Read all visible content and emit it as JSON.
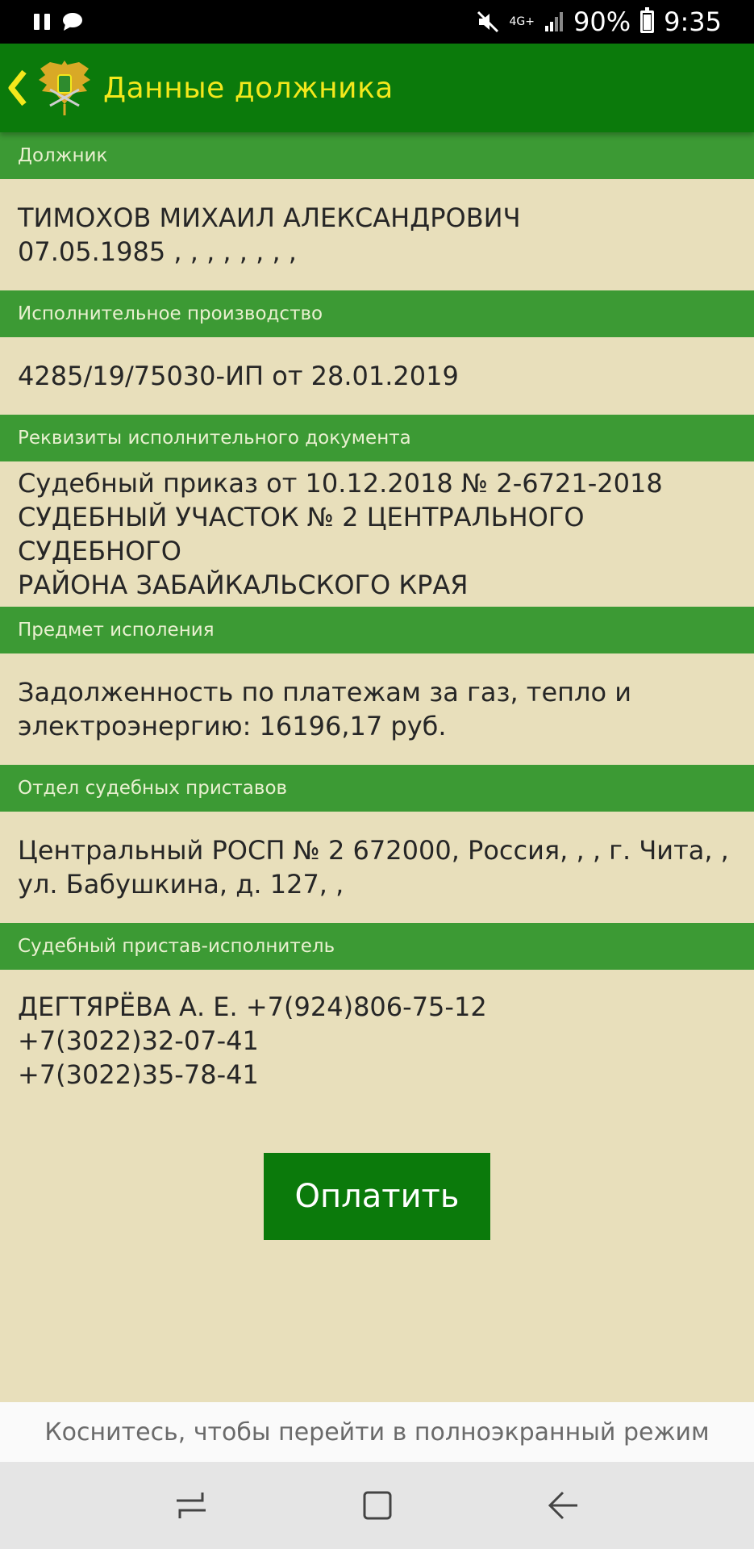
{
  "status_bar": {
    "battery": "90%",
    "time": "9:35",
    "network": "4G+"
  },
  "appbar": {
    "title": "Данные должника"
  },
  "sections": [
    {
      "header": "Должник",
      "lines": [
        "ТИМОХОВ МИХАИЛ АЛЕКСАНДРОВИЧ",
        "07.05.1985 , , , , , , , ,"
      ]
    },
    {
      "header": "Исполнительное производство",
      "lines": [
        "4285/19/75030-ИП от 28.01.2019"
      ]
    },
    {
      "header": "Реквизиты исполнительного документа",
      "lines": [
        "Судебный приказ от 10.12.2018 № 2-6721-2018",
        "СУДЕБНЫЙ УЧАСТОК № 2 ЦЕНТРАЛЬНОГО СУДЕБНОГО",
        "РАЙОНА ЗАБАЙКАЛЬСКОГО КРАЯ"
      ]
    },
    {
      "header": "Предмет исполения",
      "lines": [
        "Задолженность по платежам за газ, тепло и",
        "электроэнергию: 16196,17 руб."
      ]
    },
    {
      "header": "Отдел судебных приставов",
      "lines": [
        "Центральный РОСП № 2 672000, Россия, , , г. Чита, ,",
        "ул. Бабушкина, д. 127, ,"
      ]
    },
    {
      "header": "Судебный пристав-исполнитель",
      "lines": [
        "ДЕГТЯРЁВА А. Е. +7(924)806-75-12",
        "+7(3022)32-07-41",
        "+7(3022)35-78-41"
      ]
    }
  ],
  "pay_button": {
    "label": "Оплатить"
  },
  "fullscreen_hint": "Коснитесь, чтобы перейти в полноэкранный режим",
  "colors": {
    "appbar": "#0b7a0b",
    "title": "#f3e81c",
    "section_header": "#3c9a34",
    "background": "#e8dfbb"
  }
}
